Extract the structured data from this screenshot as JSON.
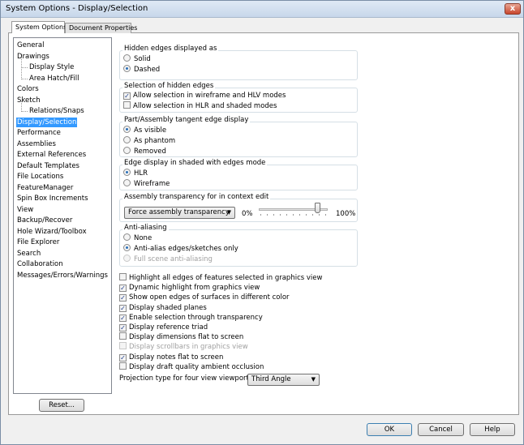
{
  "window": {
    "title": "System Options - Display/Selection",
    "close_label": "x"
  },
  "tabs": [
    "System Options",
    "Document Properties"
  ],
  "tree": {
    "items": [
      {
        "label": "General",
        "level": 0
      },
      {
        "label": "Drawings",
        "level": 0
      },
      {
        "label": "Display Style",
        "level": 1
      },
      {
        "label": "Area Hatch/Fill",
        "level": 1
      },
      {
        "label": "Colors",
        "level": 0
      },
      {
        "label": "Sketch",
        "level": 0
      },
      {
        "label": "Relations/Snaps",
        "level": 1
      },
      {
        "label": "Display/Selection",
        "level": 0,
        "selected": true
      },
      {
        "label": "Performance",
        "level": 0
      },
      {
        "label": "Assemblies",
        "level": 0
      },
      {
        "label": "External References",
        "level": 0
      },
      {
        "label": "Default Templates",
        "level": 0
      },
      {
        "label": "File Locations",
        "level": 0
      },
      {
        "label": "FeatureManager",
        "level": 0
      },
      {
        "label": "Spin Box Increments",
        "level": 0
      },
      {
        "label": "View",
        "level": 0
      },
      {
        "label": "Backup/Recover",
        "level": 0
      },
      {
        "label": "Hole Wizard/Toolbox",
        "level": 0
      },
      {
        "label": "File Explorer",
        "level": 0
      },
      {
        "label": "Search",
        "level": 0
      },
      {
        "label": "Collaboration",
        "level": 0
      },
      {
        "label": "Messages/Errors/Warnings",
        "level": 0
      }
    ],
    "reset_label": "Reset..."
  },
  "hidden_edges": {
    "title": "Hidden edges displayed as",
    "options": [
      {
        "label": "Solid",
        "checked": false
      },
      {
        "label": "Dashed",
        "checked": true
      }
    ]
  },
  "hidden_selection": {
    "title": "Selection of hidden edges",
    "options": [
      {
        "label": "Allow selection in wireframe and HLV modes",
        "checked": true
      },
      {
        "label": "Allow selection in HLR and shaded modes",
        "checked": false
      }
    ]
  },
  "tangent": {
    "title": "Part/Assembly tangent edge display",
    "options": [
      {
        "label": "As visible",
        "checked": true
      },
      {
        "label": "As phantom",
        "checked": false
      },
      {
        "label": "Removed",
        "checked": false
      }
    ]
  },
  "edge_shaded": {
    "title": "Edge display in shaded with edges mode",
    "options": [
      {
        "label": "HLR",
        "checked": true
      },
      {
        "label": "Wireframe",
        "checked": false
      }
    ]
  },
  "transparency": {
    "title": "Assembly transparency for in context edit",
    "select": "Force assembly transparency",
    "min_label": "0%",
    "max_label": "100%",
    "value_percent": 88
  },
  "antialias": {
    "title": "Anti-aliasing",
    "options": [
      {
        "label": "None",
        "checked": false
      },
      {
        "label": "Anti-alias edges/sketches only",
        "checked": true
      },
      {
        "label": "Full scene anti-aliasing",
        "checked": false,
        "disabled": true
      }
    ]
  },
  "checks": [
    {
      "label": "Highlight all edges of features selected in graphics view",
      "checked": false
    },
    {
      "label": "Dynamic highlight from graphics view",
      "checked": true
    },
    {
      "label": "Show open edges of surfaces in different color",
      "checked": true
    },
    {
      "label": "Display shaded planes",
      "checked": true
    },
    {
      "label": "Enable selection through transparency",
      "checked": true
    },
    {
      "label": "Display reference triad",
      "checked": true
    },
    {
      "label": "Display dimensions flat to screen",
      "checked": false
    },
    {
      "label": "Display scrollbars in graphics view",
      "checked": false,
      "disabled": true
    },
    {
      "label": "Display notes flat to screen",
      "checked": true
    },
    {
      "label": "Display draft quality ambient occlusion",
      "checked": false
    }
  ],
  "projection": {
    "label": "Projection type for four view viewport:",
    "value": "Third Angle"
  },
  "buttons": {
    "ok": "OK",
    "cancel": "Cancel",
    "help": "Help"
  },
  "colors": {
    "selection": "#3399ff",
    "title_bar": "#c7d7ea"
  }
}
